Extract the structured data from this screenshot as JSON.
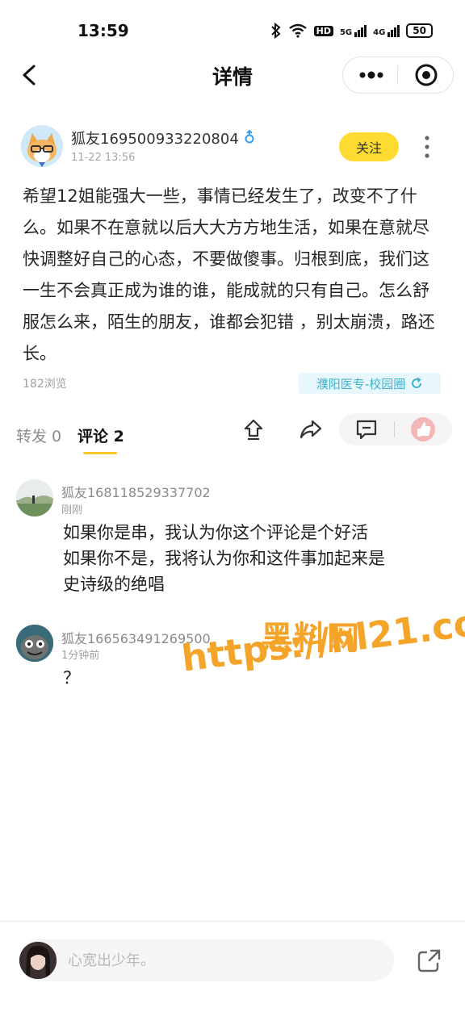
{
  "status_bar": {
    "time": "13:59",
    "network_5g": "5G",
    "network_4g": "4G",
    "hd": "HD",
    "battery": "50"
  },
  "nav": {
    "title": "详情"
  },
  "post": {
    "author": "狐友169500933220804",
    "timestamp": "11-22 13:56",
    "follow_label": "关注",
    "content": "希望12姐能强大一些，事情已经发生了，改变不了什么。如果不在意就以后大大方方地生活，如果在意就尽快调整好自己的心态，不要做傻事。归根到底，我们这一生不会真正成为谁的谁，能成就的只有自己。怎么舒服怎么来，陌生的朋友，谁都会犯错 ，别太崩溃，路还长。",
    "views": "182浏览",
    "circle": "濮阳医专-校园圈"
  },
  "tabs": {
    "forward": "转发 0",
    "comments": "评论 2"
  },
  "comments": [
    {
      "author": "狐友168118529337702",
      "time": "刚刚",
      "text": "如果你是串，我认为你这个评论是个好活\n如果你不是，我将认为你和这件事加起来是\n史诗级的绝唱"
    },
    {
      "author": "狐友166563491269500",
      "time": "1分钟前",
      "text": "？"
    }
  ],
  "watermark": {
    "line1": "黑料网",
    "line2": "https://hl21.co"
  },
  "bottom": {
    "placeholder": "心宽出少年。"
  },
  "colors": {
    "accent_yellow": "#fddb31",
    "tab_underline": "#fdc829",
    "circle_tag_text": "#3fb2ce",
    "circle_tag_bg": "#e8f7fb",
    "watermark": "#f4a529"
  }
}
